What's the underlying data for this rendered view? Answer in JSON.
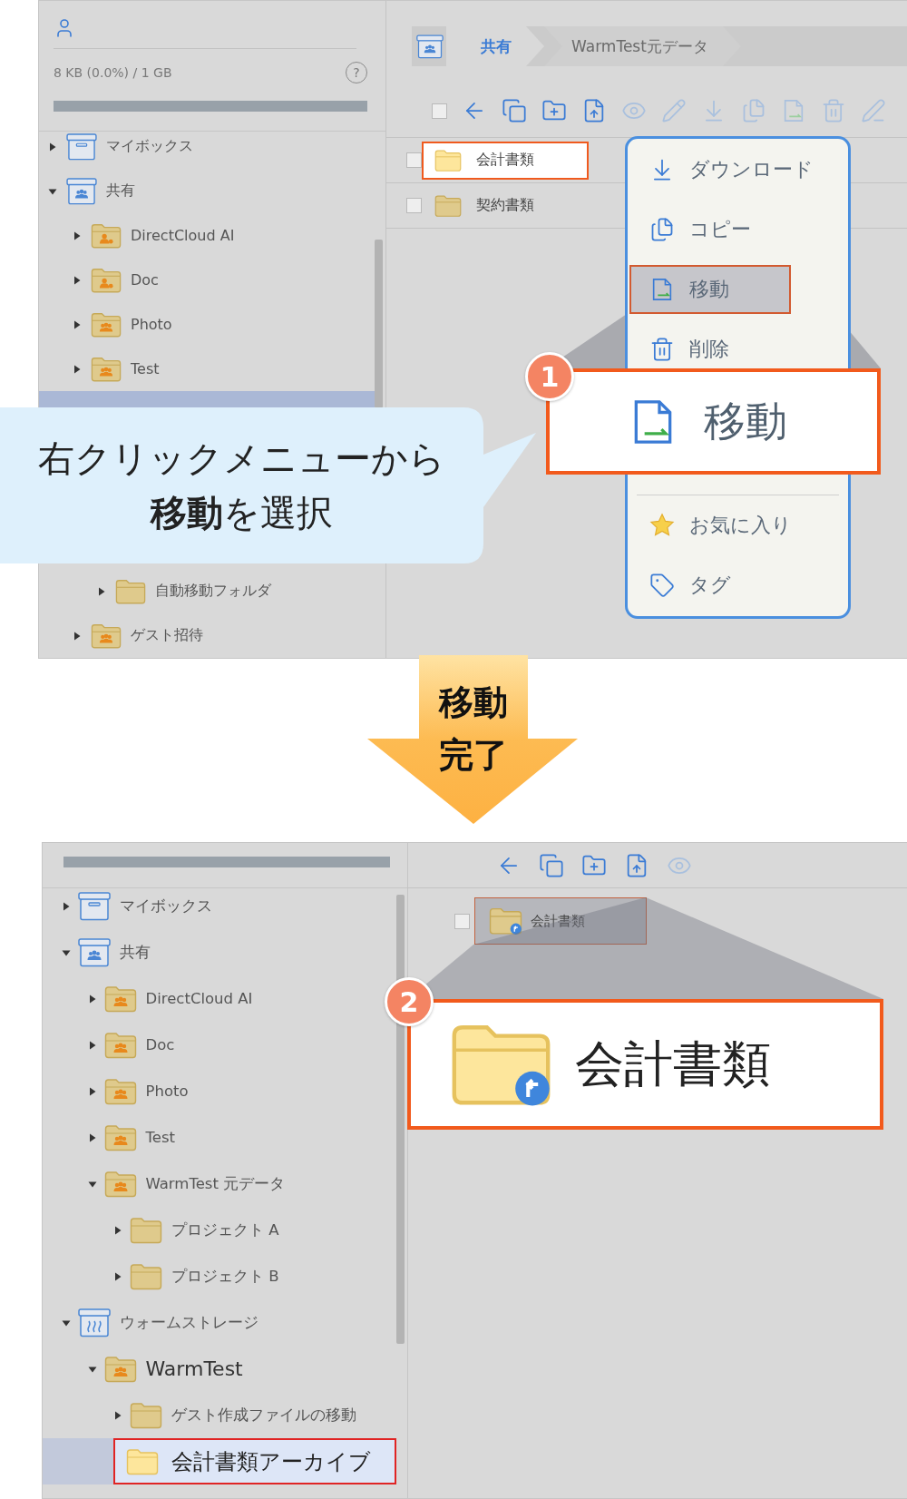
{
  "before": {
    "sidebar": {
      "usage": "8 KB (0.0%) / 1 GB",
      "help": "?",
      "tree": [
        {
          "name": "マイボックス",
          "kind": "box",
          "expanded": false,
          "selected": false
        },
        {
          "name": "共有",
          "kind": "shared-box",
          "expanded": true,
          "selected": false,
          "children": [
            {
              "name": "DirectCloud AI",
              "kind": "user-folder",
              "expanded": false,
              "selected": false
            },
            {
              "name": "Doc",
              "kind": "user-folder",
              "expanded": false,
              "selected": false
            },
            {
              "name": "Photo",
              "kind": "group-folder",
              "expanded": false,
              "selected": false
            },
            {
              "name": "Test",
              "kind": "group-folder",
              "expanded": false,
              "selected": false
            },
            {
              "selected": true,
              "children": [
                {
                  "name": "自動移動フォルダ",
                  "kind": "folder",
                  "expanded": false,
                  "selected": false
                }
              ]
            },
            {
              "name": "ゲスト招待",
              "kind": "group-folder",
              "expanded": false,
              "selected": false
            }
          ]
        }
      ]
    },
    "breadcrumb": [
      {
        "label": "共有",
        "selected": false
      },
      {
        "label": "WarmTest元データ",
        "selected": true
      }
    ],
    "toolbar": {
      "select_all": {
        "checked": false
      },
      "buttons": [
        {
          "kind": "back",
          "disabled": false
        },
        {
          "kind": "duplicate",
          "disabled": false
        },
        {
          "kind": "new-folder",
          "disabled": false
        },
        {
          "kind": "upload",
          "disabled": false
        },
        {
          "kind": "preview",
          "disabled": true
        },
        {
          "kind": "rename",
          "disabled": true
        },
        {
          "kind": "download",
          "disabled": true
        },
        {
          "kind": "copy",
          "disabled": true
        },
        {
          "kind": "move",
          "disabled": true
        },
        {
          "kind": "delete",
          "disabled": true
        },
        {
          "kind": "edit",
          "disabled": true
        }
      ]
    },
    "files": [
      {
        "name": "会計書類",
        "kind": "folder",
        "checked": false,
        "highlighted": true
      },
      {
        "name": "契約書類",
        "kind": "folder",
        "checked": false,
        "highlighted": false
      }
    ],
    "context_menu": {
      "items": [
        {
          "kind": "download",
          "label": "ダウンロード",
          "selected": false
        },
        {
          "kind": "copy",
          "label": "コピー",
          "selected": false
        },
        {
          "kind": "move",
          "label": "移動",
          "selected": true
        },
        {
          "kind": "delete",
          "label": "削除",
          "selected": false
        },
        {
          "kind": "divider"
        },
        {
          "kind": "star",
          "label": "お気に入り",
          "selected": false
        },
        {
          "kind": "tag",
          "label": "タグ",
          "selected": false
        }
      ]
    },
    "callout": {
      "badge": "1",
      "kind": "move",
      "label": "移動"
    },
    "speech_bubble": {
      "lines": [
        "右クリックメニューから",
        "**移動**を選択"
      ]
    }
  },
  "transition": {
    "lines": [
      "移動",
      "完了"
    ]
  },
  "after": {
    "sidebar": {
      "tree": [
        {
          "name": "マイボックス",
          "kind": "box",
          "expanded": false,
          "selected": false,
          "emphasis": false
        },
        {
          "name": "共有",
          "kind": "shared-box",
          "expanded": true,
          "selected": false,
          "emphasis": false,
          "children": [
            {
              "name": "DirectCloud AI",
              "kind": "group-folder",
              "expanded": false,
              "selected": false,
              "emphasis": false
            },
            {
              "name": "Doc",
              "kind": "group-folder",
              "expanded": false,
              "selected": false,
              "emphasis": false
            },
            {
              "name": "Photo",
              "kind": "group-folder",
              "expanded": false,
              "selected": false,
              "emphasis": false
            },
            {
              "name": "Test",
              "kind": "group-folder",
              "expanded": false,
              "selected": false,
              "emphasis": false
            },
            {
              "name": "WarmTest 元データ",
              "kind": "group-folder",
              "expanded": true,
              "selected": false,
              "emphasis": false,
              "children": [
                {
                  "name": "プロジェクト A",
                  "kind": "folder",
                  "expanded": false,
                  "selected": false,
                  "emphasis": false
                },
                {
                  "name": "プロジェクト B",
                  "kind": "folder",
                  "expanded": false,
                  "selected": false,
                  "emphasis": false
                }
              ]
            }
          ]
        },
        {
          "name": "ウォームストレージ",
          "kind": "warm-box",
          "expanded": true,
          "selected": false,
          "emphasis": false,
          "children": [
            {
              "name": "WarmTest",
              "kind": "group-folder",
              "expanded": true,
              "selected": false,
              "emphasis": true,
              "children": [
                {
                  "name": "ゲスト作成ファイルの移動",
                  "kind": "folder",
                  "expanded": false,
                  "selected": false,
                  "emphasis": false
                },
                {
                  "name": "会計書類アーカイブ",
                  "kind": "folder",
                  "selected": true,
                  "emphasis": true
                }
              ]
            }
          ]
        }
      ]
    },
    "toolbar": {
      "buttons": [
        {
          "kind": "back",
          "disabled": false
        },
        {
          "kind": "duplicate",
          "disabled": false
        },
        {
          "kind": "new-folder",
          "disabled": false
        },
        {
          "kind": "upload",
          "disabled": false
        },
        {
          "kind": "preview",
          "disabled": true
        }
      ]
    },
    "files": [
      {
        "name": "会計書類",
        "kind": "linked-folder",
        "checked": false,
        "highlighted": true
      }
    ],
    "callout": {
      "badge": "2",
      "kind": "linked-folder",
      "label": "会計書類"
    }
  }
}
